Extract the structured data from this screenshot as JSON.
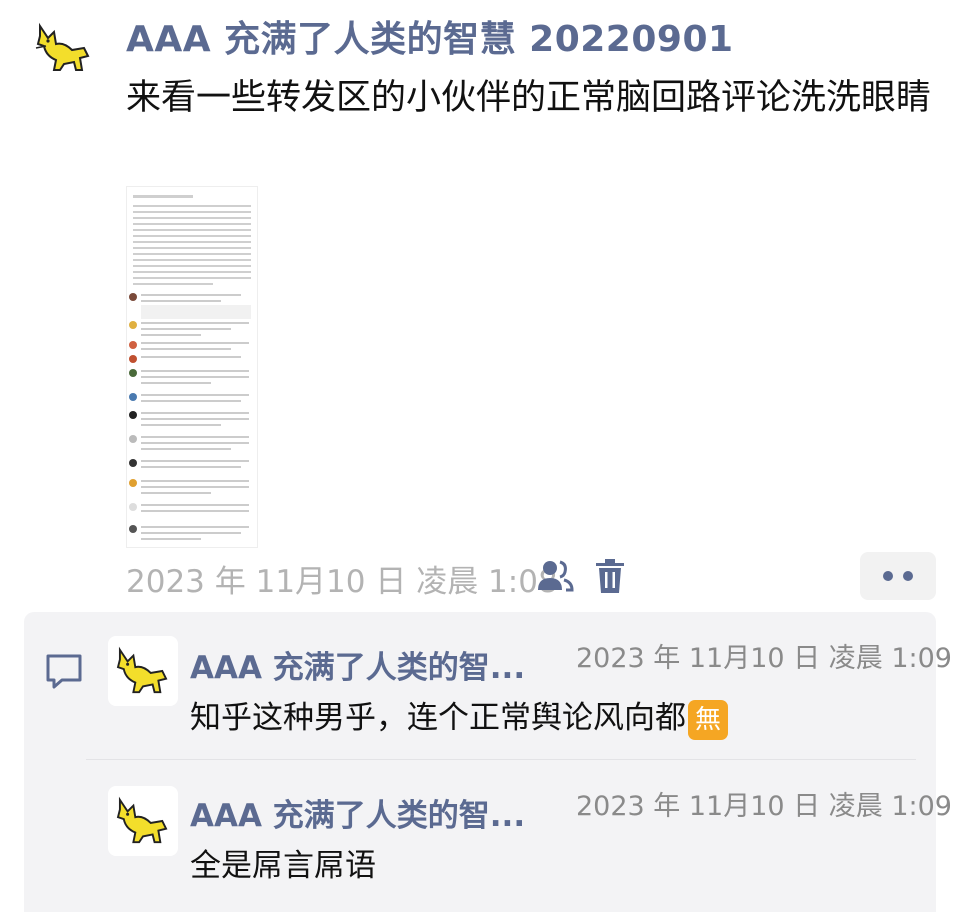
{
  "post": {
    "author": "AAA 充满了人类的智慧 20220901",
    "text": "来看一些转发区的小伙伴的正常脑回路评论洗洗眼睛",
    "timestamp": "2023 年 11月10 日 凌晨 1:08",
    "icons": [
      "cat-avatar-icon",
      "friends-icon",
      "trash-icon",
      "more-dots-icon"
    ]
  },
  "comments": [
    {
      "author": "AAA 充满了人类的智...",
      "time": "2023 年 11月10 日 凌晨 1:09",
      "text": "知乎这种男乎，连个正常舆论风向都",
      "badge": "無"
    },
    {
      "author": "AAA 充满了人类的智...",
      "time": "2023 年 11月10 日 凌晨 1:09",
      "text": "全是屌言屌语"
    }
  ],
  "colors": {
    "name": "#5b6a91",
    "meta": "#b3b3b3",
    "comment_bg": "#f3f3f5",
    "badge": "#f5a623"
  }
}
